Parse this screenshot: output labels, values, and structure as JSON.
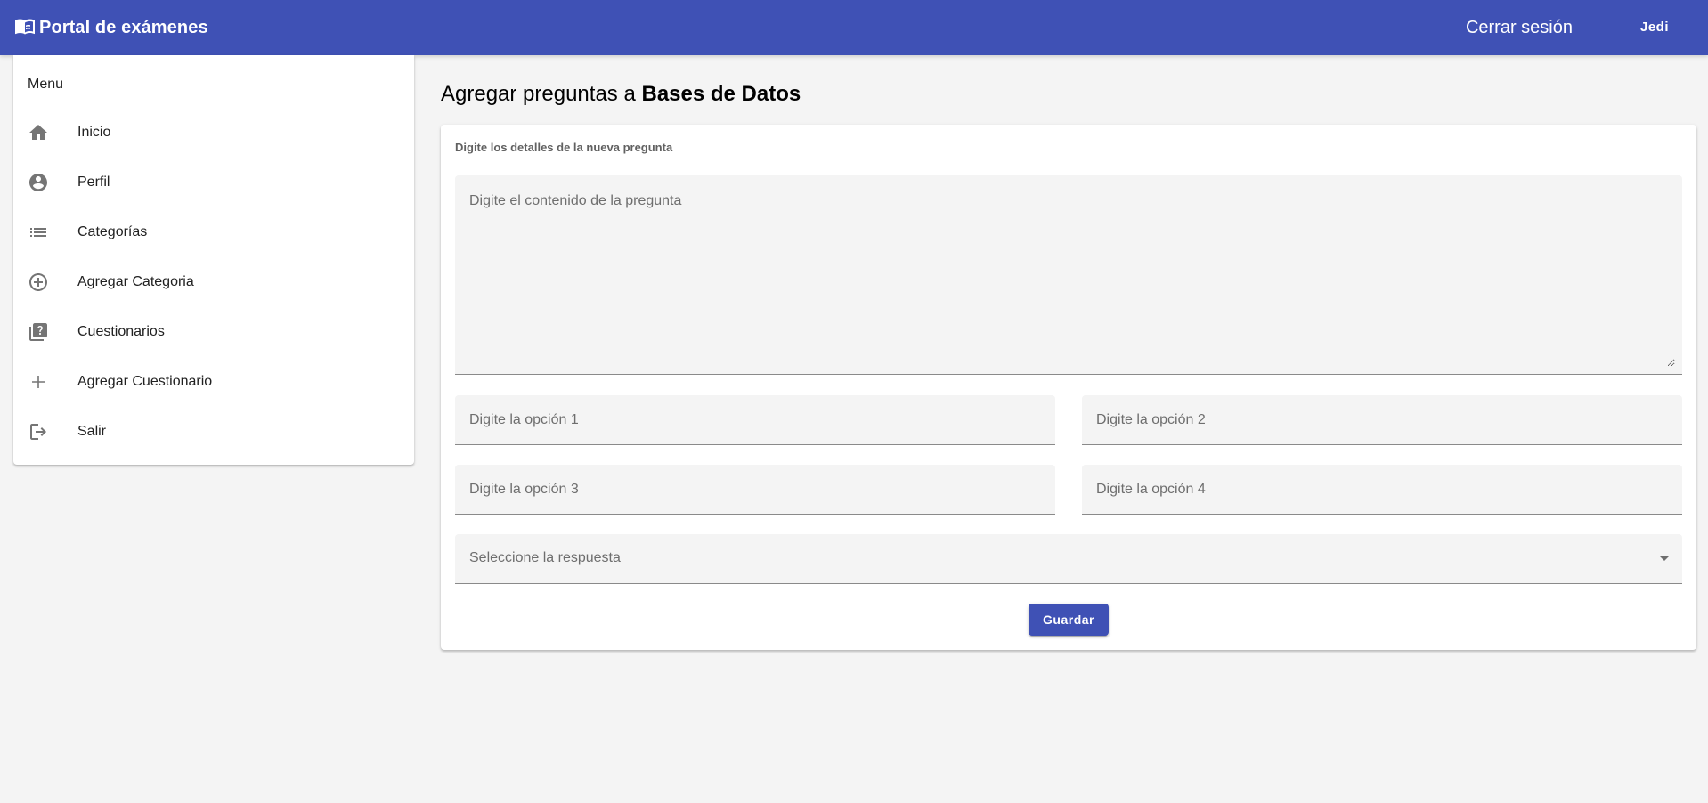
{
  "app": {
    "brand_icon": "menu-book-icon",
    "title": "Portal de exámenes",
    "logout_label": "Cerrar sesión",
    "user_label": "Jedi",
    "accent_color": "#3f51b5",
    "background_color": "#f4f4f4"
  },
  "sidebar": {
    "header": "Menu",
    "items": [
      {
        "label": "Inicio",
        "icon": "home-icon"
      },
      {
        "label": "Perfil",
        "icon": "account-circle-icon"
      },
      {
        "label": "Categorías",
        "icon": "list-icon"
      },
      {
        "label": "Agregar Categoria",
        "icon": "add-circle-outline-icon"
      },
      {
        "label": "Cuestionarios",
        "icon": "quiz-icon"
      },
      {
        "label": "Agregar Cuestionario",
        "icon": "add-icon"
      },
      {
        "label": "Salir",
        "icon": "logout-icon"
      }
    ]
  },
  "main": {
    "title_prefix": "Agregar preguntas a",
    "title_category": "Bases de Datos",
    "form": {
      "subtitle": "Digite los detalles de la nueva pregunta",
      "content_placeholder": "Digite el contenido de la pregunta",
      "option1_placeholder": "Digite la opción 1",
      "option2_placeholder": "Digite la opción 2",
      "option3_placeholder": "Digite la opción 3",
      "option4_placeholder": "Digite la opción 4",
      "answer_label": "Seleccione la respuesta",
      "save_label": "Guardar"
    }
  }
}
